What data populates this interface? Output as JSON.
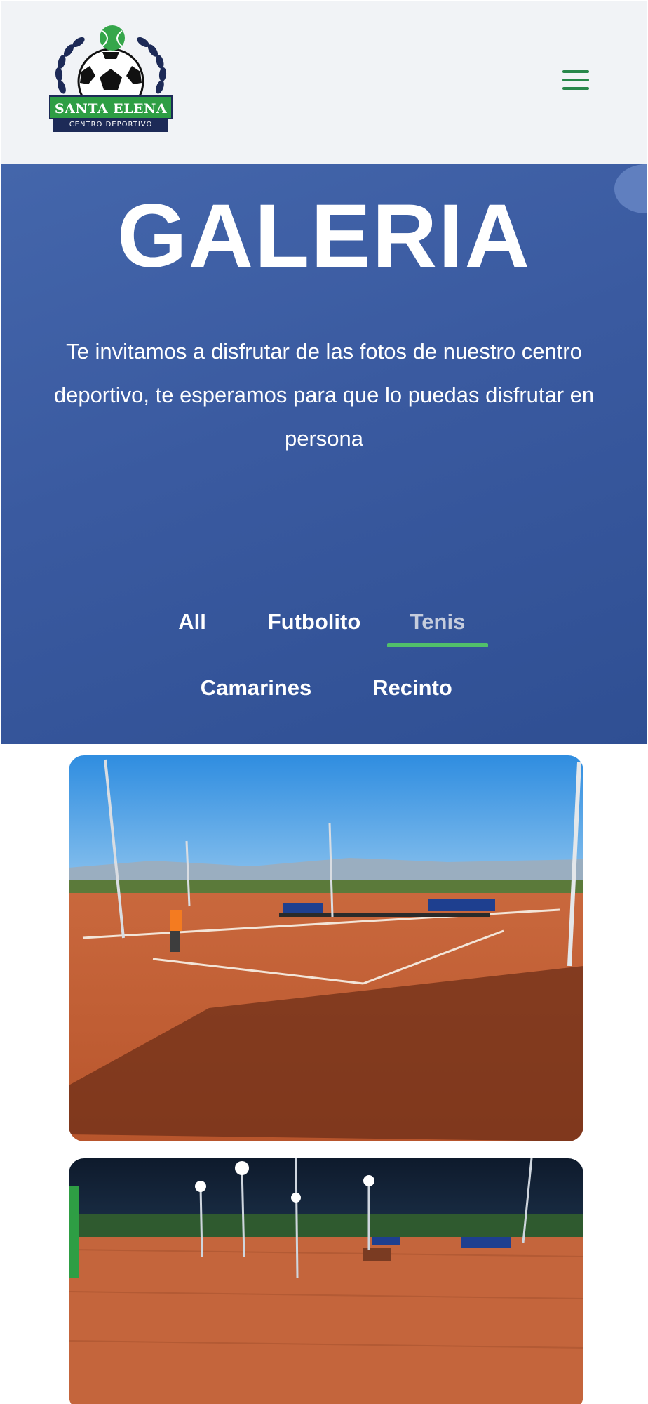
{
  "brand": {
    "name": "SANTA ELENA",
    "subtitle": "CENTRO DEPORTIVO"
  },
  "header": {
    "menu_icon": "hamburger-menu-icon"
  },
  "hero": {
    "title": "GALERIA",
    "description": "Te invitamos a disfrutar de las fotos de nuestro centro deportivo, te esperamos para que lo puedas disfrutar en persona"
  },
  "tabs": [
    {
      "label": "All",
      "active": false
    },
    {
      "label": "Futbolito",
      "active": false
    },
    {
      "label": "Tenis",
      "active": true
    },
    {
      "label": "Camarines",
      "active": false
    },
    {
      "label": "Recinto",
      "active": false
    }
  ],
  "colors": {
    "header_bg": "#f1f3f6",
    "hero_bg": "#3a5aa0",
    "accent_green": "#51c06a",
    "menu_icon": "#27874a",
    "brand_navy": "#1d2a57"
  }
}
